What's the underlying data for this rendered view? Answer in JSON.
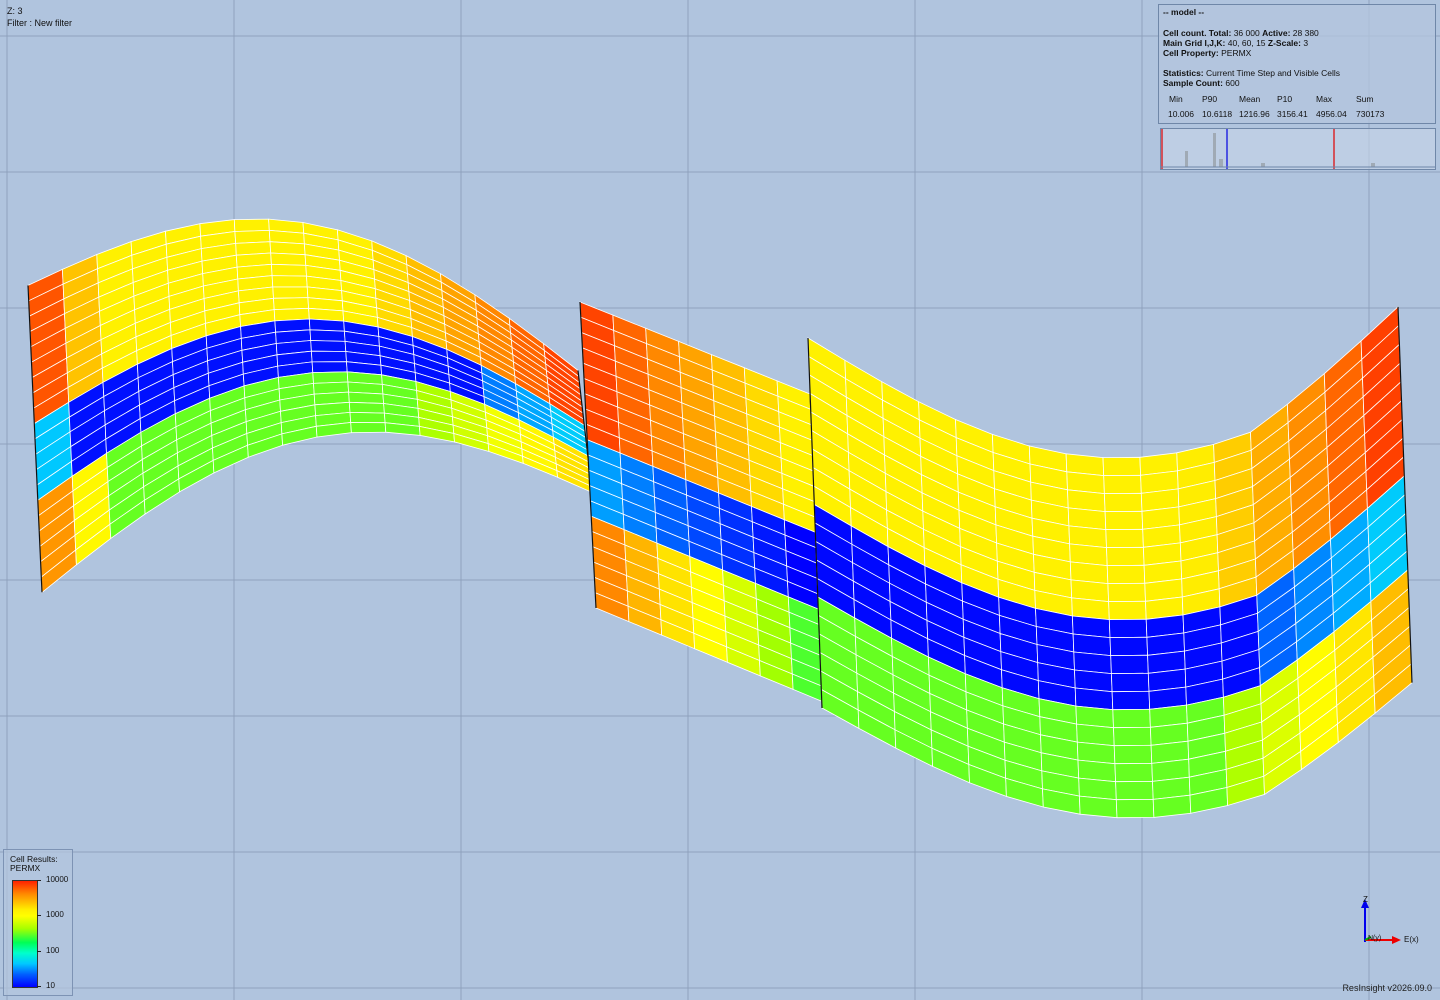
{
  "viewer": {
    "z_label": "Z: 3",
    "filter_label": "Filter : New filter",
    "version": "ResInsight v2026.09.0",
    "background": "#b0c4de",
    "grid_line_color": "#8fa2bd"
  },
  "info": {
    "title": "-- model --",
    "cell_count_label": "Cell count. Total:",
    "cell_count_total": "36 000",
    "active_label": "Active:",
    "active": "28 380",
    "main_grid_label": "Main Grid I,J,K:",
    "main_grid": "40, 60, 15",
    "z_scale_label": "Z-Scale:",
    "z_scale": "3",
    "cell_property_label": "Cell Property:",
    "cell_property": "PERMX",
    "statistics_label": "Statistics:",
    "statistics": "Current Time Step and Visible Cells",
    "sample_count_label": "Sample Count:",
    "sample_count": "600",
    "stats_headers": [
      "Min",
      "P90",
      "Mean",
      "P10",
      "Max",
      "Sum"
    ],
    "stats_values": [
      "10.006",
      "10.6118",
      "1216.96",
      "3156.41",
      "4956.04",
      "730173"
    ]
  },
  "legend": {
    "title": "Cell Results:",
    "property": "PERMX",
    "ticks": [
      "10000",
      "1000",
      "100",
      "10"
    ]
  },
  "axes": {
    "x": "E(x)",
    "z": "Z",
    "y": "N(y)"
  }
}
